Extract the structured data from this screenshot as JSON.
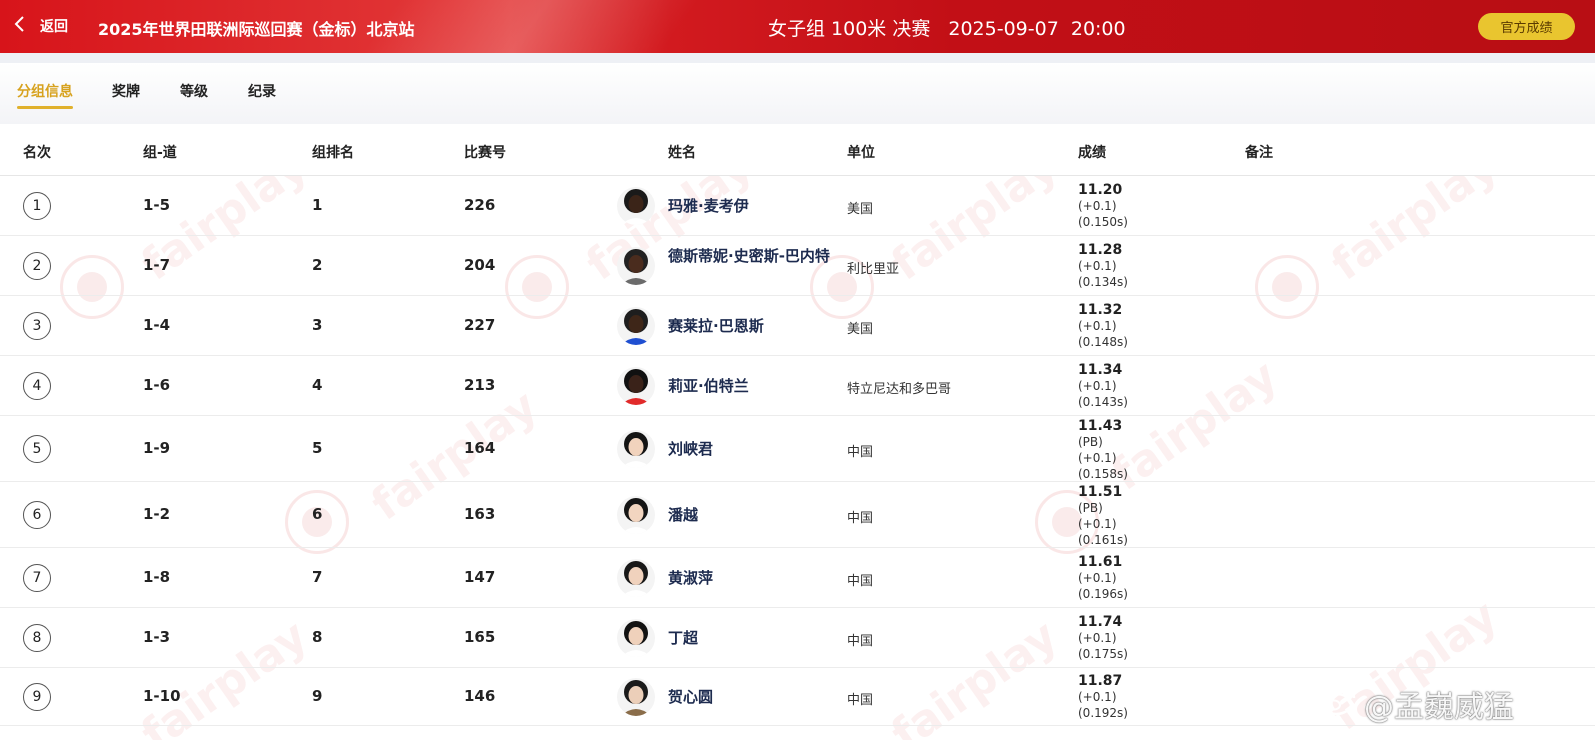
{
  "header": {
    "back_label": "返回",
    "event_title": "2025年世界田联洲际巡回赛（金标）北京站",
    "race_name": "女子组 100米 决赛",
    "race_datetime": "2025-09-07  20:00",
    "official_button": "官方成绩"
  },
  "tabs": [
    {
      "label": "分组信息",
      "active": true
    },
    {
      "label": "奖牌",
      "active": false
    },
    {
      "label": "等级",
      "active": false
    },
    {
      "label": "纪录",
      "active": false
    }
  ],
  "table": {
    "headers": {
      "rank": "名次",
      "group_lane": "组-道",
      "group_rank": "组排名",
      "bib": "比赛号",
      "name": "姓名",
      "unit": "单位",
      "result": "成绩",
      "note": "备注"
    },
    "rows": [
      {
        "rank": "1",
        "group_lane": "1-5",
        "group_rank": "1",
        "bib": "226",
        "name": "玛雅·麦考伊",
        "unit": "美国",
        "time": "11.20",
        "extra": [
          "(+0.1)",
          "(0.150s)"
        ]
      },
      {
        "rank": "2",
        "group_lane": "1-7",
        "group_rank": "2",
        "bib": "204",
        "name": "德斯蒂妮·史密斯-巴内特",
        "unit": "利比里亚",
        "time": "11.28",
        "extra": [
          "(+0.1)",
          "(0.134s)"
        ]
      },
      {
        "rank": "3",
        "group_lane": "1-4",
        "group_rank": "3",
        "bib": "227",
        "name": "赛莱拉·巴恩斯",
        "unit": "美国",
        "time": "11.32",
        "extra": [
          "(+0.1)",
          "(0.148s)"
        ]
      },
      {
        "rank": "4",
        "group_lane": "1-6",
        "group_rank": "4",
        "bib": "213",
        "name": "莉亚·伯特兰",
        "unit": "特立尼达和多巴哥",
        "time": "11.34",
        "extra": [
          "(+0.1)",
          "(0.143s)"
        ]
      },
      {
        "rank": "5",
        "group_lane": "1-9",
        "group_rank": "5",
        "bib": "164",
        "name": "刘峡君",
        "unit": "中国",
        "time": "11.43",
        "extra": [
          "(PB)",
          "(+0.1)",
          "(0.158s)"
        ]
      },
      {
        "rank": "6",
        "group_lane": "1-2",
        "group_rank": "6",
        "bib": "163",
        "name": "潘越",
        "unit": "中国",
        "time": "11.51",
        "extra": [
          "(PB)",
          "(+0.1)",
          "(0.161s)"
        ]
      },
      {
        "rank": "7",
        "group_lane": "1-8",
        "group_rank": "7",
        "bib": "147",
        "name": "黄淑萍",
        "unit": "中国",
        "time": "11.61",
        "extra": [
          "(+0.1)",
          "(0.196s)"
        ]
      },
      {
        "rank": "8",
        "group_lane": "1-3",
        "group_rank": "8",
        "bib": "165",
        "name": "丁超",
        "unit": "中国",
        "time": "11.74",
        "extra": [
          "(+0.1)",
          "(0.175s)"
        ]
      },
      {
        "rank": "9",
        "group_lane": "1-10",
        "group_rank": "9",
        "bib": "146",
        "name": "贺心圆",
        "unit": "中国",
        "time": "11.87",
        "extra": [
          "(+0.1)",
          "(0.192s)"
        ]
      }
    ]
  },
  "watermark": {
    "text": "fairplay",
    "weibo_handle": "@孟巍威猛"
  },
  "colors": {
    "header_red": "#d7141a",
    "accent_gold": "#e0b12d",
    "official_button": "#e9c52f",
    "name_navy": "#1d2b4f"
  },
  "icons": [
    "back-chevron-icon",
    "weibo-icon"
  ]
}
